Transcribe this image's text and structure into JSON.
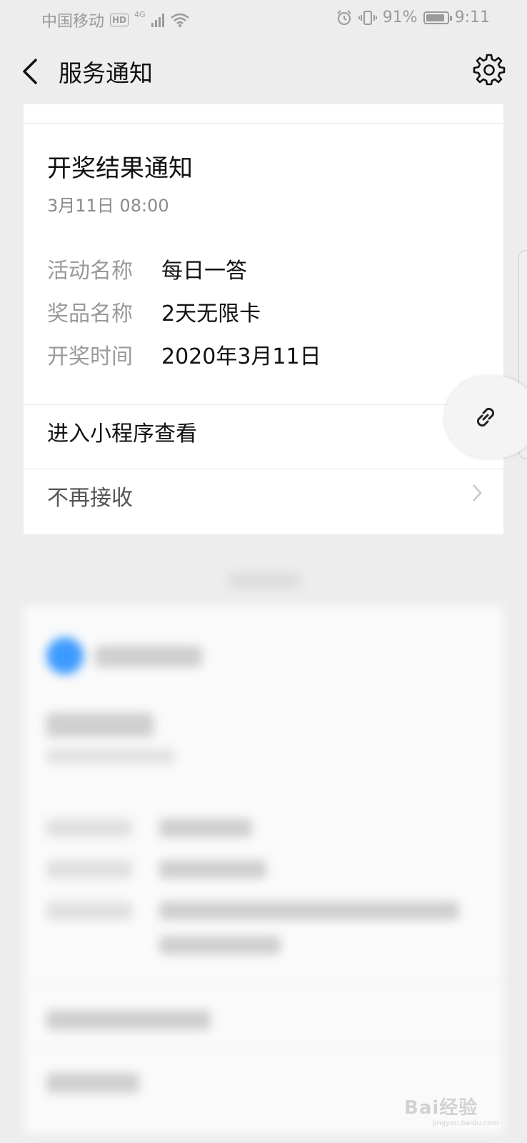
{
  "status_bar": {
    "carrier": "中国移动",
    "hd": "HD",
    "network": "4G",
    "battery": "91%",
    "battery_level": 0.91,
    "time": "9:11"
  },
  "header": {
    "title": "服务通知"
  },
  "notification": {
    "title": "开奖结果通知",
    "time": "3月11日  08:00",
    "fields": [
      {
        "key": "活动名称",
        "value": "每日一答"
      },
      {
        "key": "奖品名称",
        "value": "2天无限卡"
      },
      {
        "key": "开奖时间",
        "value": "2020年3月11日"
      }
    ],
    "open_mini_program": "进入小程序查看",
    "unsubscribe": "不再接收"
  },
  "watermark": {
    "brand": "Bai经验",
    "url": "jingyan.baidu.com"
  },
  "colors": {
    "background": "#ededed",
    "card": "#ffffff",
    "label": "#9a9a9a",
    "blur_avatar": "#3d9bff"
  }
}
